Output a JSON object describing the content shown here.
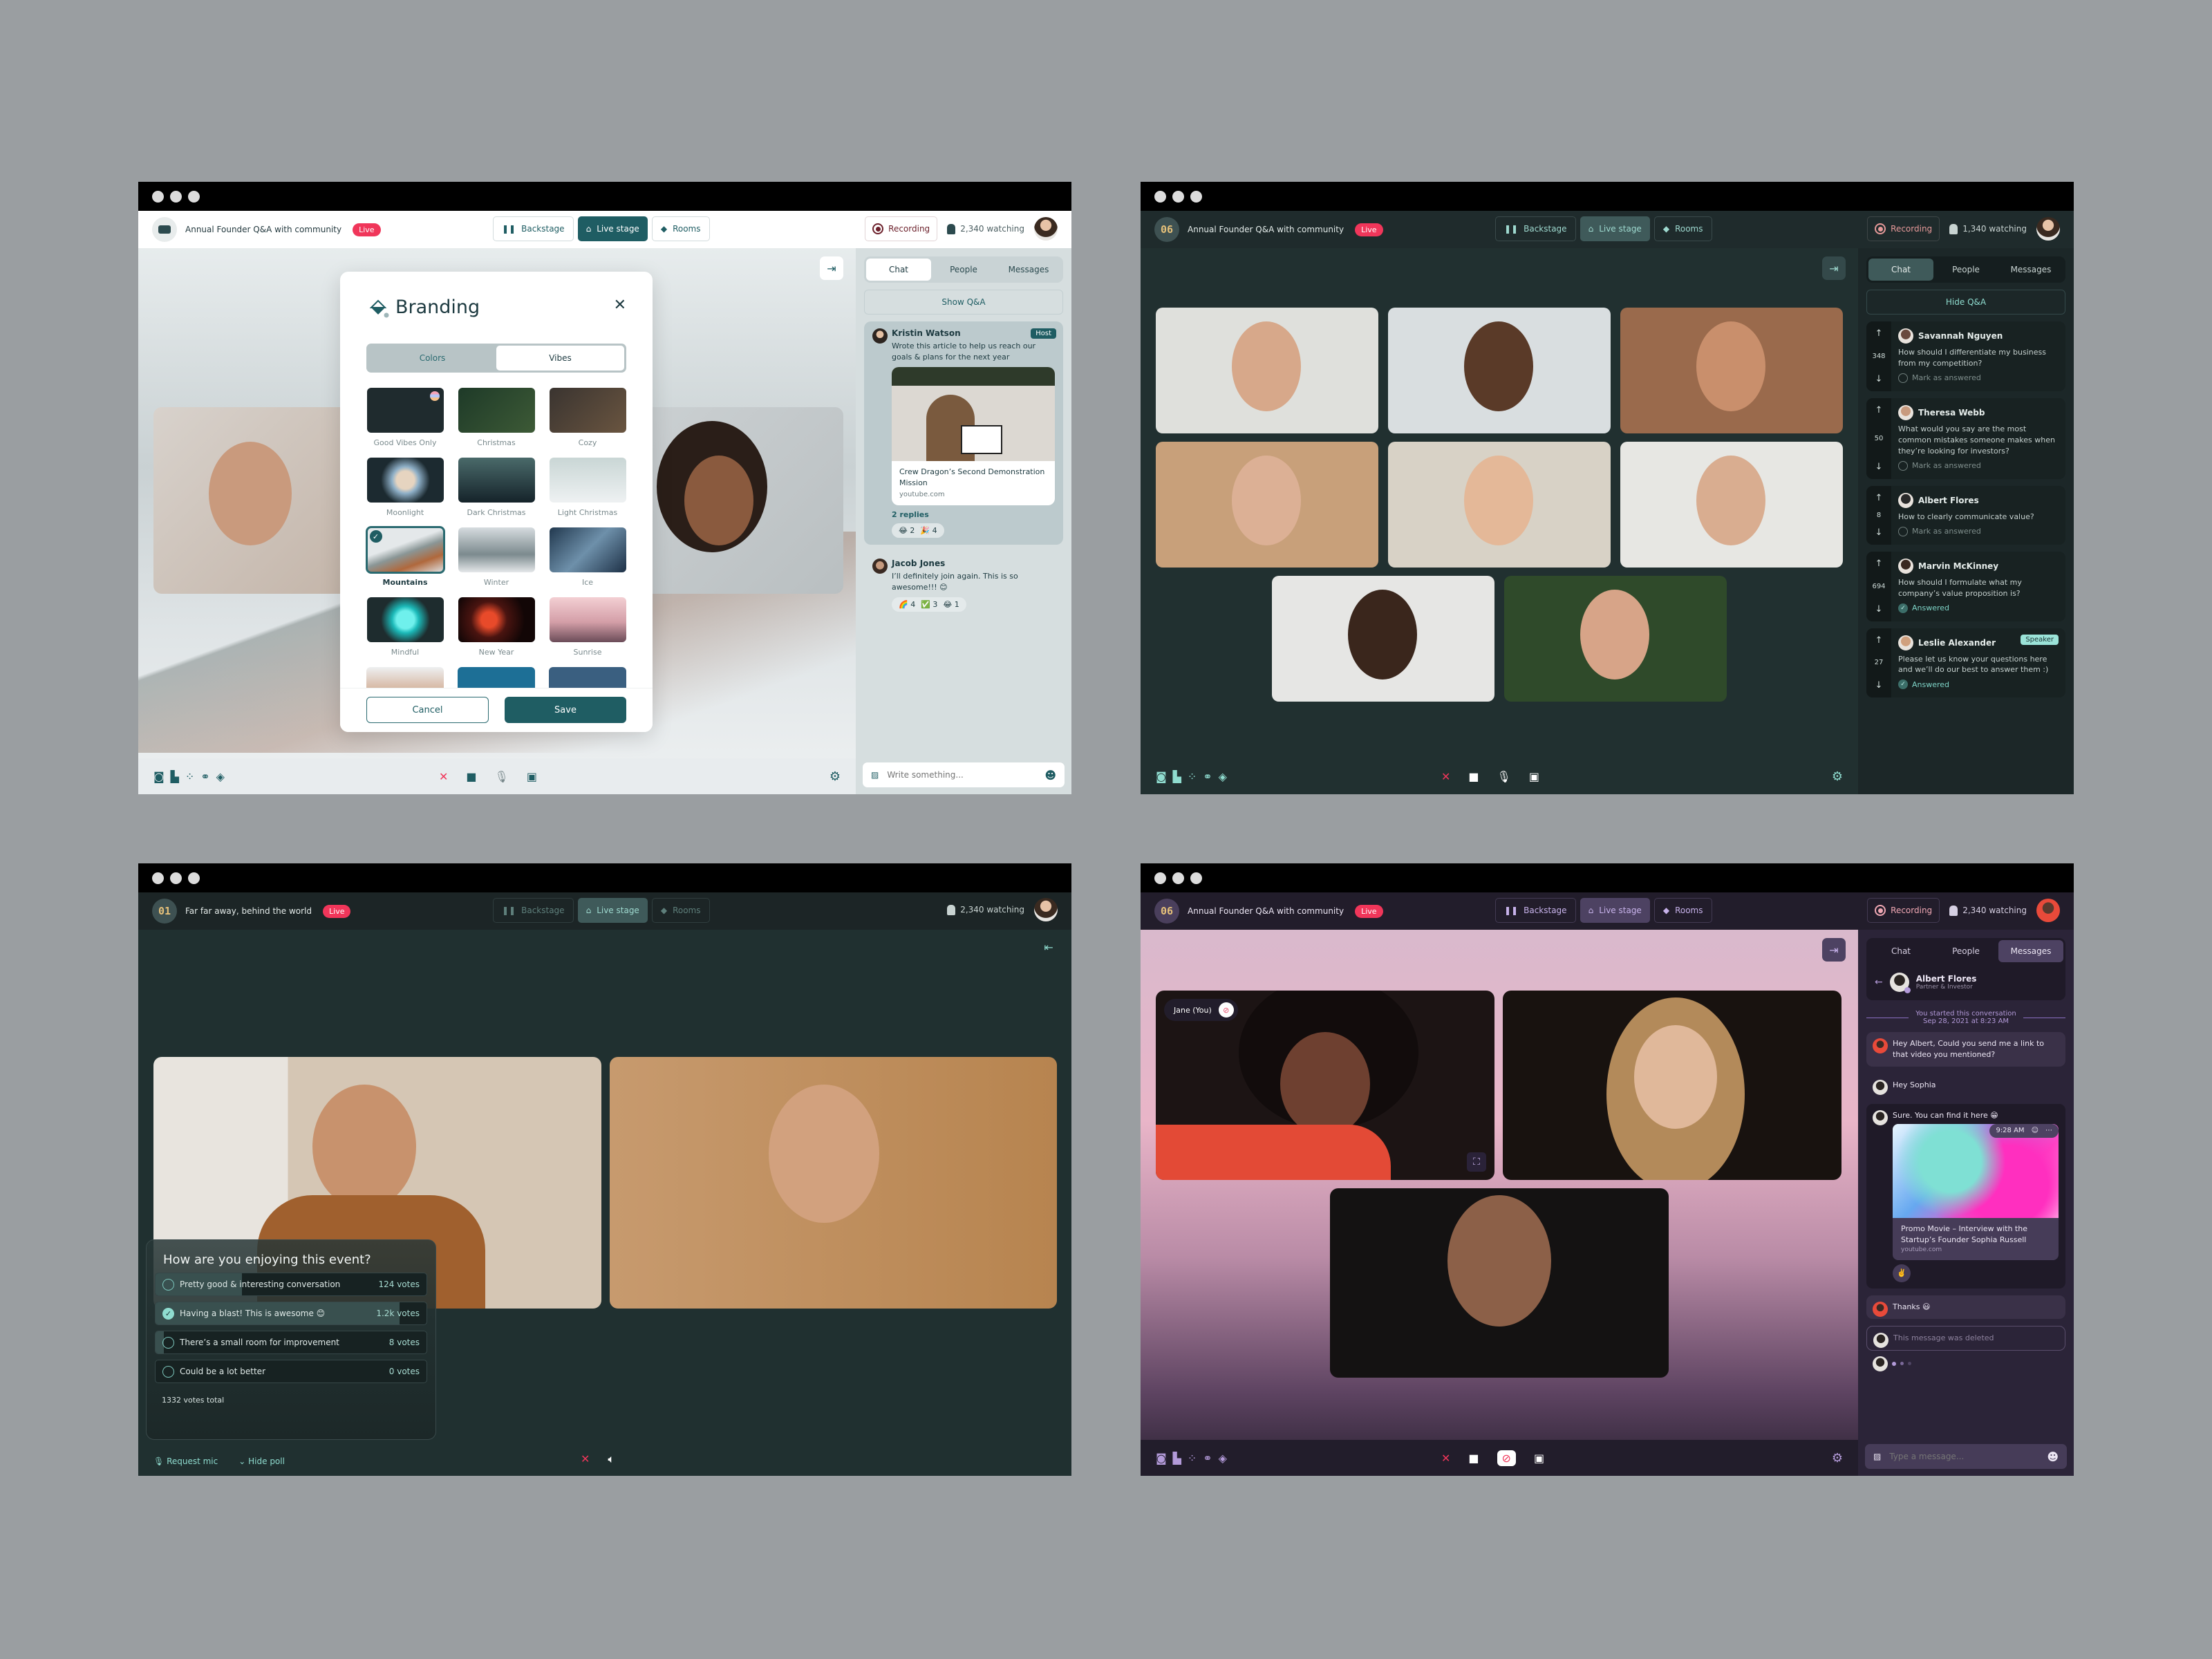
{
  "window_controls": [
    "close",
    "minimize",
    "maximize"
  ],
  "nav": {
    "backstage": "Backstage",
    "live_stage": "Live stage",
    "rooms": "Rooms"
  },
  "live_badge": "Live",
  "recording_label": "Recording",
  "sidebar_tabs": {
    "chat": "Chat",
    "people": "People",
    "messages": "Messages"
  },
  "toolbar_icons": [
    "camera-icon",
    "chart-icon",
    "nodes-icon",
    "link-icon",
    "paint-bucket-icon"
  ],
  "window1": {
    "logo": "",
    "event_title": "Annual Founder Q&A with community",
    "watching": "2,340 watching",
    "modal": {
      "title": "Branding",
      "close": "✕",
      "segments": [
        "Colors",
        "Vibes"
      ],
      "active_segment": "Vibes",
      "vibes": [
        {
          "label": "Good Vibes Only",
          "selected": false
        },
        {
          "label": "Christmas",
          "selected": false
        },
        {
          "label": "Cozy",
          "selected": false
        },
        {
          "label": "Moonlight",
          "selected": false
        },
        {
          "label": "Dark Christmas",
          "selected": false
        },
        {
          "label": "Light Christmas",
          "selected": false
        },
        {
          "label": "Mountains",
          "selected": true
        },
        {
          "label": "Winter",
          "selected": false
        },
        {
          "label": "Ice",
          "selected": false
        },
        {
          "label": "Mindful",
          "selected": false
        },
        {
          "label": "New Year",
          "selected": false
        },
        {
          "label": "Sunrise",
          "selected": false
        }
      ],
      "cancel": "Cancel",
      "save": "Save"
    },
    "sidebar": {
      "active_tab": "Chat",
      "qa_toggle": "Show Q&A",
      "messages": [
        {
          "name": "Kristin Watson",
          "badge": "Host",
          "text": "Wrote this article to help us reach our goals & plans for the next year",
          "link": {
            "title": "Crew Dragon’s Second Demonstration Mission",
            "source": "youtube.com"
          },
          "replies": "2 replies",
          "reactions": [
            {
              "emoji": "😂",
              "count": "2"
            },
            {
              "emoji": "🎉",
              "count": "4"
            }
          ]
        },
        {
          "name": "Jacob Jones",
          "text": "I’ll definitely join again. This is so awesome!!! 😊",
          "reactions": [
            {
              "emoji": "🌈",
              "count": "4"
            },
            {
              "emoji": "✅",
              "count": "3"
            },
            {
              "emoji": "😂",
              "count": "1"
            }
          ]
        }
      ],
      "composer_placeholder": "Write something..."
    }
  },
  "window2": {
    "logo": "06",
    "event_title": "Annual Founder Q&A with community",
    "watching": "1,340 watching",
    "sidebar": {
      "active_tab": "Chat",
      "qa_toggle": "Hide Q&A",
      "questions": [
        {
          "name": "Savannah Nguyen",
          "votes": "348",
          "text": "How should I differentiate my business from my competition?",
          "status": "Mark as answered",
          "answered": false
        },
        {
          "name": "Theresa Webb",
          "votes": "50",
          "text": "What would you say are the most common mistakes someone makes when they’re looking for investors?",
          "status": "Mark as answered",
          "answered": false
        },
        {
          "name": "Albert Flores",
          "votes": "8",
          "text": "How to clearly communicate value?",
          "status": "Mark as answered",
          "answered": false
        },
        {
          "name": "Marvin McKinney",
          "votes": "694",
          "text": "How should I formulate what my company’s value proposition is?",
          "status": "Answered",
          "answered": true
        },
        {
          "name": "Leslie Alexander",
          "votes": "27",
          "badge": "Speaker",
          "text": "Please let us know your questions here and we’ll do our best to answer them :)",
          "status": "Answered",
          "answered": true
        }
      ]
    }
  },
  "window3": {
    "logo": "01",
    "event_title": "Far far away, behind the world",
    "watching": "2,340 watching",
    "poll": {
      "question": "How are you enjoying this event?",
      "options": [
        {
          "label": "Pretty good & interesting conversation",
          "votes": "124 votes",
          "share": 0.32,
          "selected": false
        },
        {
          "label": "Having a blast! This is awesome 😊",
          "votes": "1.2k votes",
          "share": 0.9,
          "selected": true
        },
        {
          "label": "There’s a small room for improvement",
          "votes": "8 votes",
          "share": 0.03,
          "selected": false
        },
        {
          "label": "Could be a lot better",
          "votes": "0 votes",
          "share": 0,
          "selected": false
        }
      ],
      "total": "1332 votes total"
    },
    "request_mic": "Request mic",
    "hide_poll": "Hide poll"
  },
  "window4": {
    "logo": "06",
    "event_title": "Annual Founder Q&A with community",
    "watching": "2,340 watching",
    "self_tile_label": "Jane (You)",
    "sidebar": {
      "active_tab": "Messages",
      "contact": {
        "name": "Albert Flores",
        "role": "Partner & Investor"
      },
      "conversation_start": "You started this conversation",
      "conversation_date": "Sep 28, 2021 at 8:23 AM",
      "messages": [
        {
          "from": "me",
          "text": "Hey Albert, Could you send me a link to that video you mentioned?"
        },
        {
          "from": "albert",
          "text": "Hey Sophia"
        },
        {
          "from": "albert",
          "text": "Sure. You can find it here 😁",
          "time": "9:28 AM",
          "link": {
            "title": "Promo Movie – Interview with the Startup’s Founder Sophia Russell",
            "source": "youtube.com"
          },
          "reaction": "✌️"
        },
        {
          "from": "me",
          "text": "Thanks 😃"
        },
        {
          "from": "albert",
          "text": "This message was deleted",
          "deleted": true
        }
      ],
      "composer_placeholder": "Type a message..."
    }
  },
  "colors": {
    "teal_primary": "#1f5d63",
    "live_red": "#f0365a",
    "mint_accent": "#8fdccf",
    "purple_accent": "#b39ad9"
  }
}
